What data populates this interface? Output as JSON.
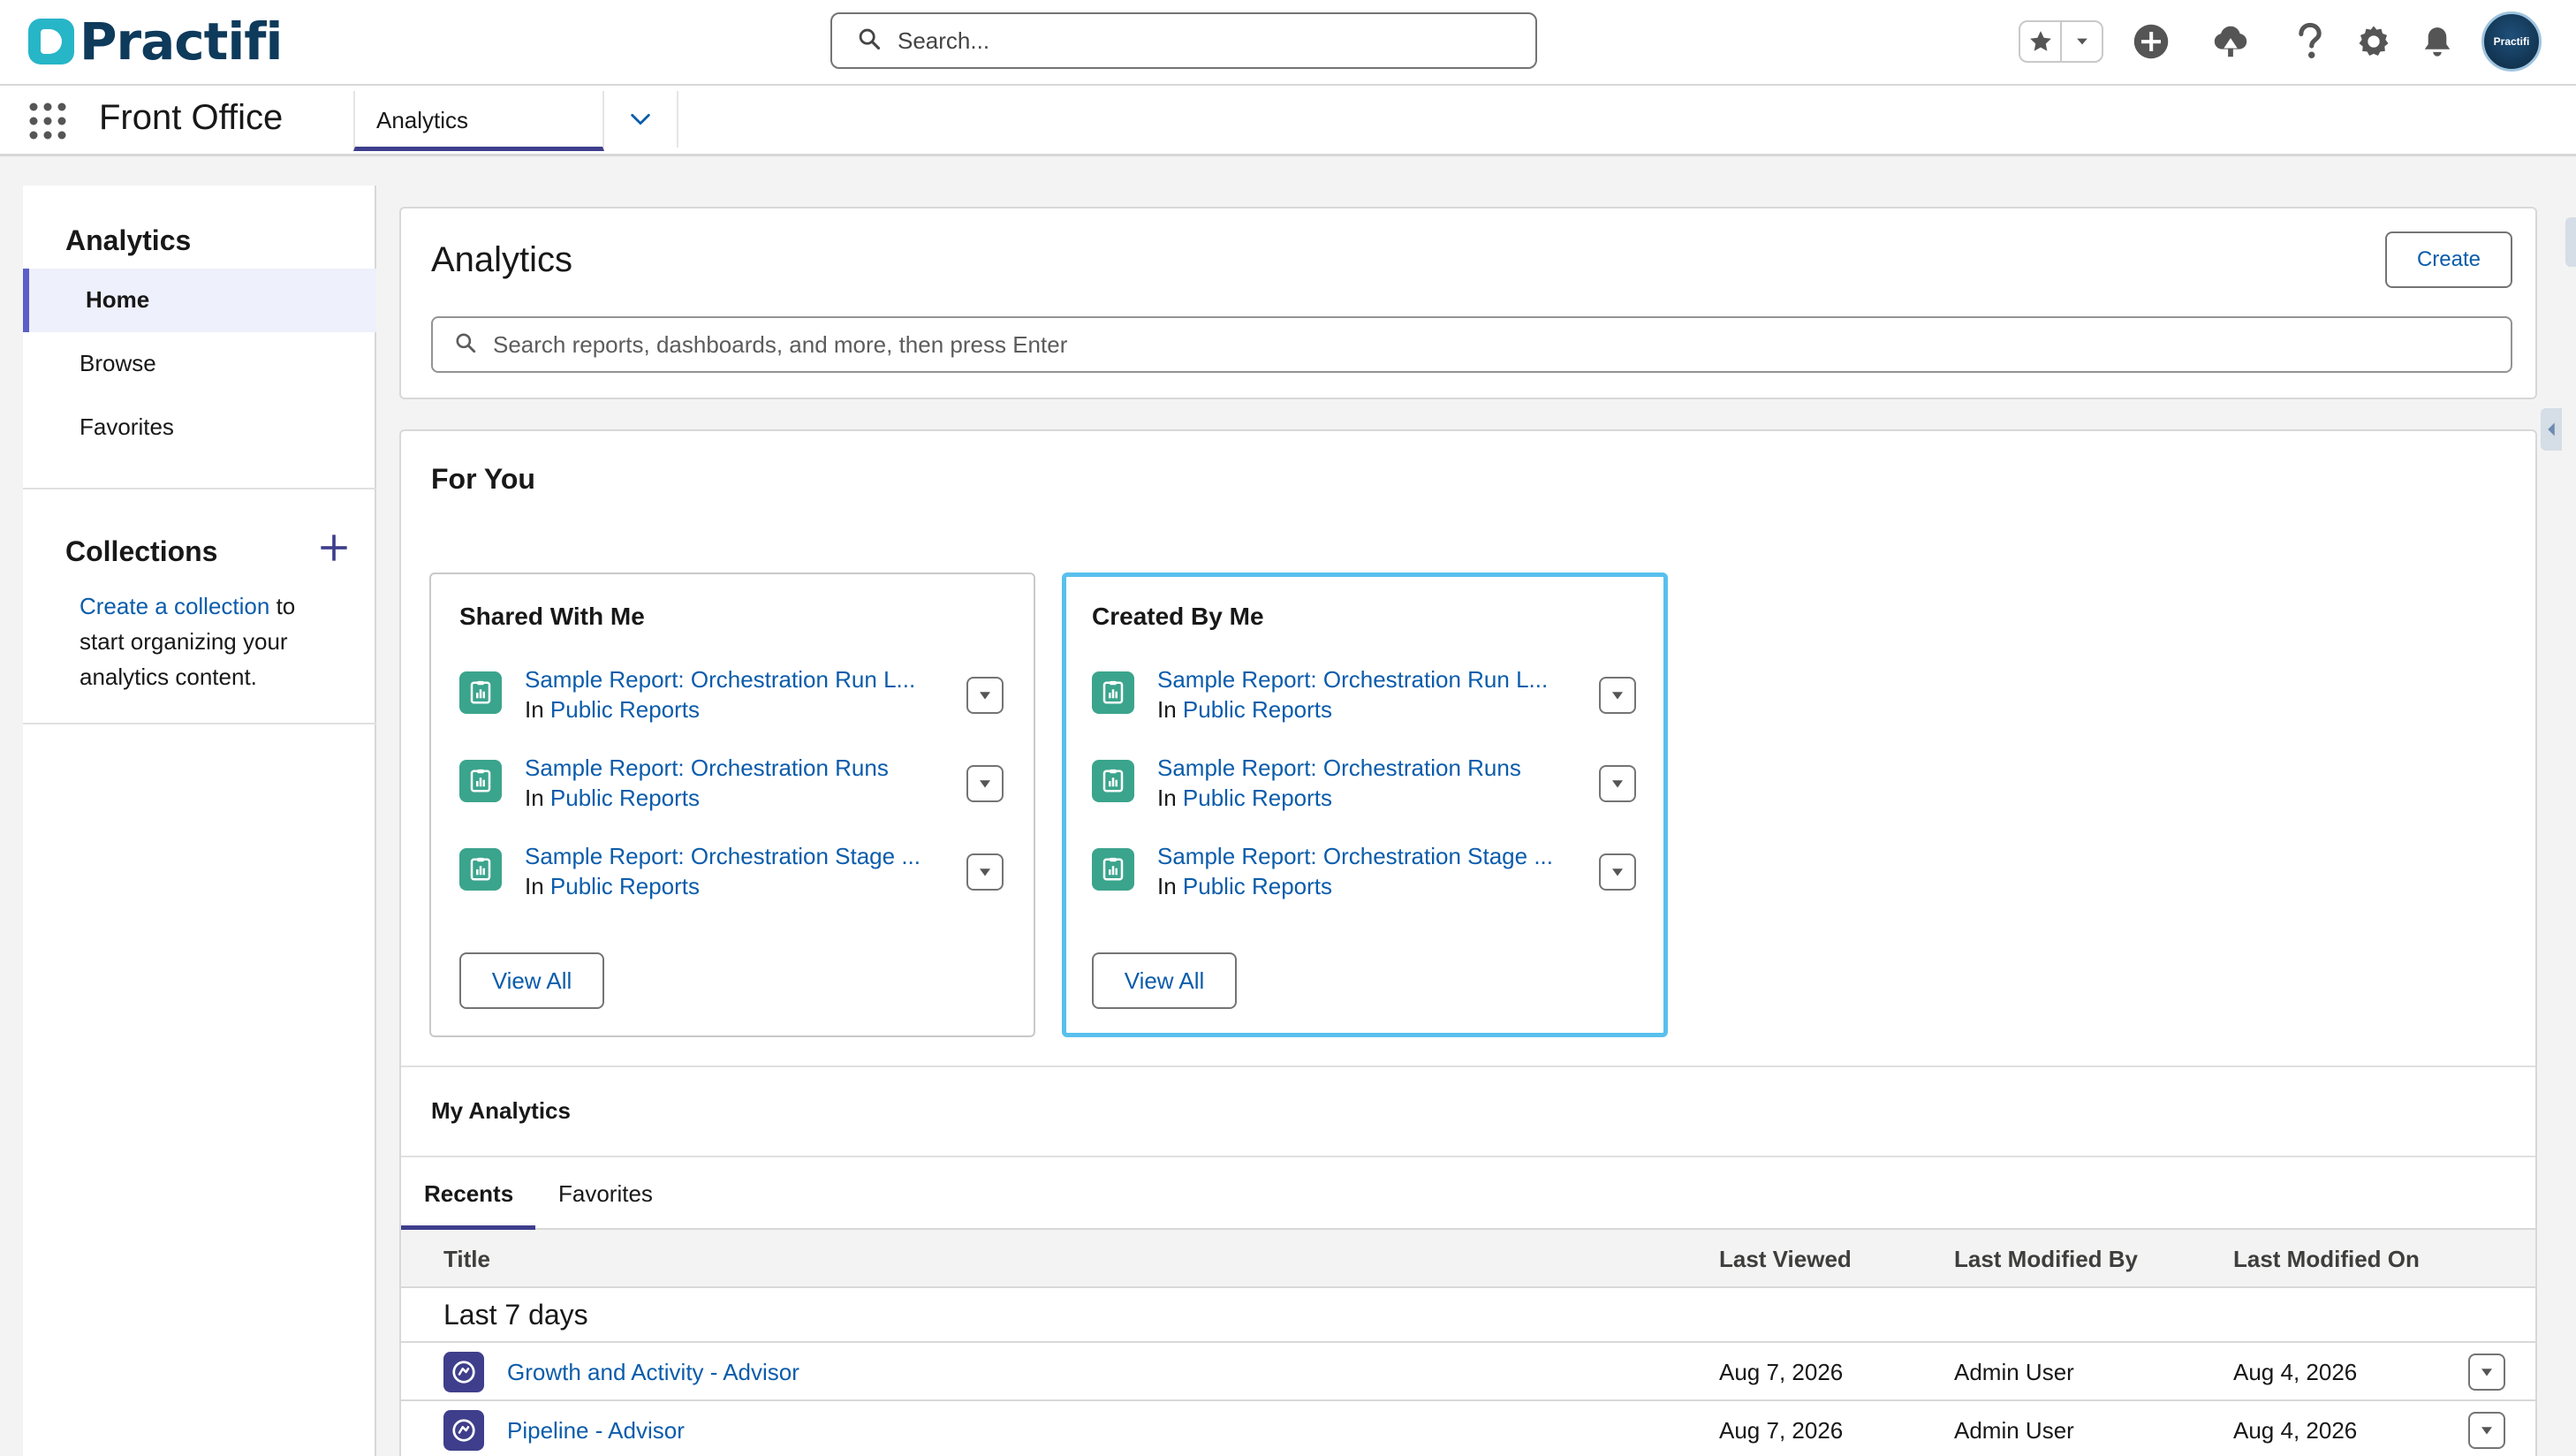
{
  "header": {
    "logo_text": "Practifi",
    "search_placeholder": "Search...",
    "avatar_label": "Practifi"
  },
  "app_nav": {
    "app_name": "Front Office",
    "active_tab": "Analytics"
  },
  "sidebar": {
    "title": "Analytics",
    "items": [
      {
        "label": "Home",
        "active": true
      },
      {
        "label": "Browse",
        "active": false
      },
      {
        "label": "Favorites",
        "active": false
      }
    ],
    "collections_title": "Collections",
    "create_collection_link": "Create a collection",
    "collections_text_1": " to",
    "collections_text_2": "start organizing your",
    "collections_text_3": "analytics content."
  },
  "analytics_header": {
    "title": "Analytics",
    "create_label": "Create",
    "search_placeholder": "Search reports, dashboards, and more, then press Enter"
  },
  "for_you": {
    "title": "For You",
    "cards": [
      {
        "title": "Shared With Me",
        "items": [
          {
            "title": "Sample Report: Orchestration Run L...",
            "prefix": "In",
            "folder": "Public Reports"
          },
          {
            "title": "Sample Report: Orchestration Runs",
            "prefix": "In",
            "folder": "Public Reports"
          },
          {
            "title": "Sample Report: Orchestration Stage ...",
            "prefix": "In",
            "folder": "Public Reports"
          }
        ],
        "view_all": "View All"
      },
      {
        "title": "Created By Me",
        "items": [
          {
            "title": "Sample Report: Orchestration Run L...",
            "prefix": "In",
            "folder": "Public Reports"
          },
          {
            "title": "Sample Report: Orchestration Runs",
            "prefix": "In",
            "folder": "Public Reports"
          },
          {
            "title": "Sample Report: Orchestration Stage ...",
            "prefix": "In",
            "folder": "Public Reports"
          }
        ],
        "view_all": "View All"
      }
    ]
  },
  "my_analytics": {
    "title": "My Analytics",
    "tabs": [
      "Recents",
      "Favorites"
    ],
    "columns": [
      "Title",
      "Last Viewed",
      "Last Modified By",
      "Last Modified On"
    ],
    "group_label": "Last 7 days",
    "rows": [
      {
        "title": "Growth and Activity - Advisor",
        "last_viewed": "Aug 7, 2026",
        "modified_by": "Admin User",
        "modified_on": "Aug 4, 2026"
      },
      {
        "title": "Pipeline - Advisor",
        "last_viewed": "Aug 7, 2026",
        "modified_by": "Admin User",
        "modified_on": "Aug 4, 2026"
      }
    ]
  },
  "colors": {
    "accent": "#3e3e8c",
    "link": "#0b5cab",
    "report_icon": "#3ba48c",
    "focus_ring": "#58c0ec",
    "logo_mark": "#27b5c8",
    "logo_text": "#0e3a5b"
  },
  "icons": [
    "search-icon",
    "star-icon",
    "chevron-down-icon",
    "add-icon",
    "trailhead-icon",
    "help-icon",
    "gear-icon",
    "bell-icon",
    "app-launcher-icon",
    "report-icon",
    "dashboard-icon"
  ]
}
